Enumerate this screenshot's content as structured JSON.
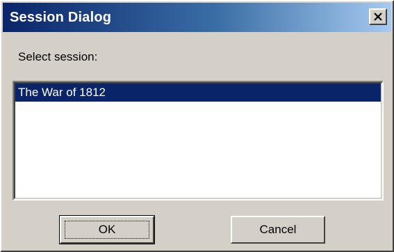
{
  "window": {
    "title": "Session Dialog",
    "close_icon": "close-icon"
  },
  "dialog": {
    "prompt": "Select session:",
    "sessions": [
      {
        "label": "The War of 1812",
        "selected": true
      }
    ]
  },
  "buttons": {
    "ok_label": "OK",
    "cancel_label": "Cancel"
  },
  "colors": {
    "titlebar_start": "#0a246a",
    "titlebar_end": "#a6caf0",
    "selection": "#0a246a",
    "face": "#d4d0c8"
  }
}
